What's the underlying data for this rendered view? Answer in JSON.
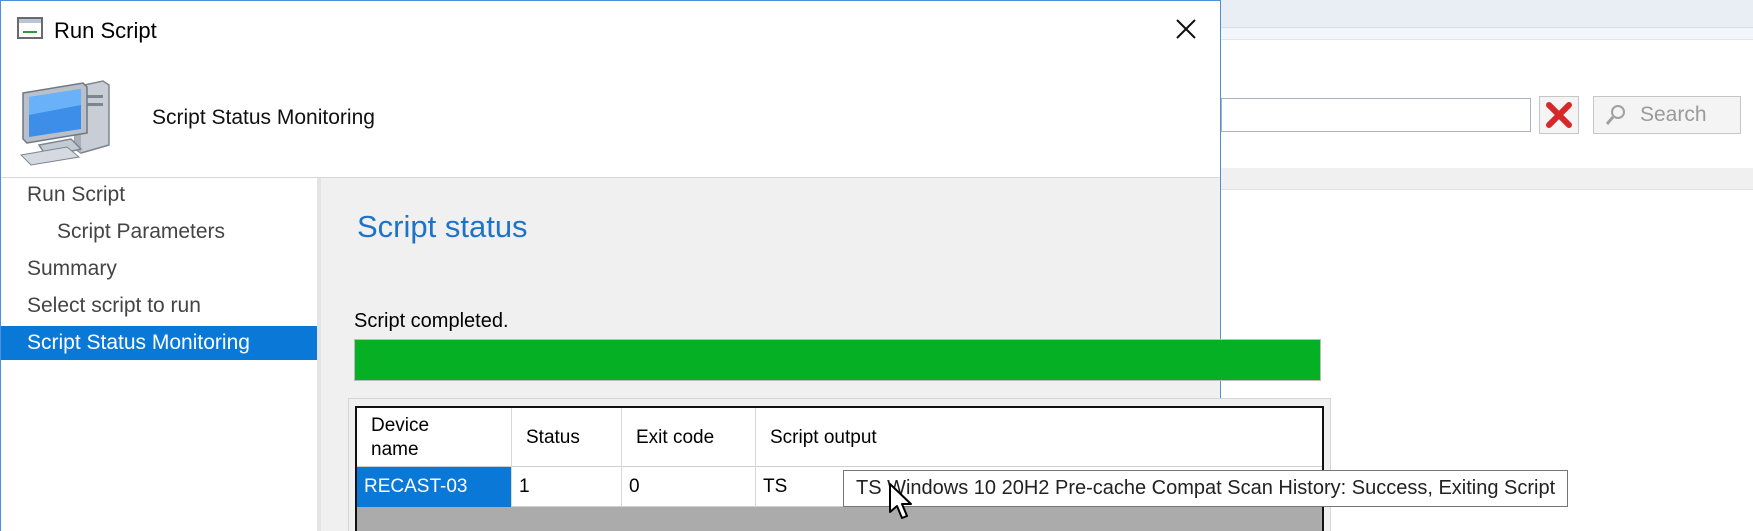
{
  "window": {
    "title": "Run Script",
    "close_icon": "close-icon"
  },
  "header": {
    "title": "Script Status Monitoring"
  },
  "nav": {
    "items": [
      {
        "label": "Run Script",
        "level": 0,
        "active": false
      },
      {
        "label": "Script Parameters",
        "level": 1,
        "active": false
      },
      {
        "label": "Summary",
        "level": 0,
        "active": false
      },
      {
        "label": "Select script to run",
        "level": 0,
        "active": false
      },
      {
        "label": "Script Status Monitoring",
        "level": 0,
        "active": true
      }
    ]
  },
  "content": {
    "title": "Script status",
    "status_text": "Script completed.",
    "progress_fraction": 1.0,
    "progress_color": "#06b025",
    "table": {
      "columns": [
        "Device name",
        "Status",
        "Exit code",
        "Script output"
      ],
      "rows": [
        {
          "device": "RECAST-03",
          "status": "1",
          "exit_code": "0",
          "output": "TS"
        }
      ]
    },
    "tooltip": "TS Windows 10 20H2 Pre-cache Compat Scan History: Success, Exiting Script"
  },
  "background_app": {
    "search_button_label": "Search",
    "clear_icon": "red-x-icon",
    "search_icon": "magnifier-icon"
  },
  "colors": {
    "accent": "#0a78d7",
    "title_blue": "#1e73c8"
  }
}
